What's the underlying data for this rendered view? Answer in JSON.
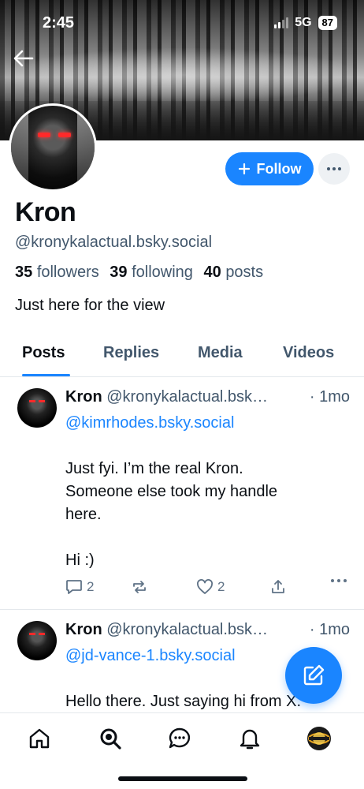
{
  "status_bar": {
    "time": "2:45",
    "network": "5G",
    "battery": "87"
  },
  "profile": {
    "display_name": "Kron",
    "handle": "@kronykalactual.bsky.social",
    "followers_count": "35",
    "followers_label": "followers",
    "following_count": "39",
    "following_label": "following",
    "posts_count": "40",
    "posts_label": "posts",
    "bio": "Just here for the view",
    "follow_label": "Follow"
  },
  "tabs": [
    {
      "label": "Posts",
      "active": true
    },
    {
      "label": "Replies",
      "active": false
    },
    {
      "label": "Media",
      "active": false
    },
    {
      "label": "Videos",
      "active": false
    }
  ],
  "posts": [
    {
      "author": "Kron",
      "handle": "@kronykalactual.bsk…",
      "time": "· 1mo",
      "mention": "@kimrhodes.bsky.social",
      "line1": "Just fyi. I’m the real Kron.",
      "line2": "Someone else took my handle",
      "line3": "here.",
      "line4": "Hi :)",
      "replies": "2",
      "likes": "2"
    },
    {
      "author": "Kron",
      "handle": "@kronykalactual.bsk…",
      "time": "· 1mo",
      "mention": "@jd-vance-1.bsky.social",
      "line1": "Hello there. Just saying hi from X."
    }
  ],
  "colors": {
    "accent": "#1a85ff",
    "muted": "#42576c"
  },
  "icons": {
    "back": "arrow-left-icon",
    "more": "ellipsis-icon",
    "compose": "pencil-icon",
    "nav": [
      "home-icon",
      "search-icon",
      "chat-icon",
      "bell-icon",
      "profile-avatar"
    ]
  }
}
